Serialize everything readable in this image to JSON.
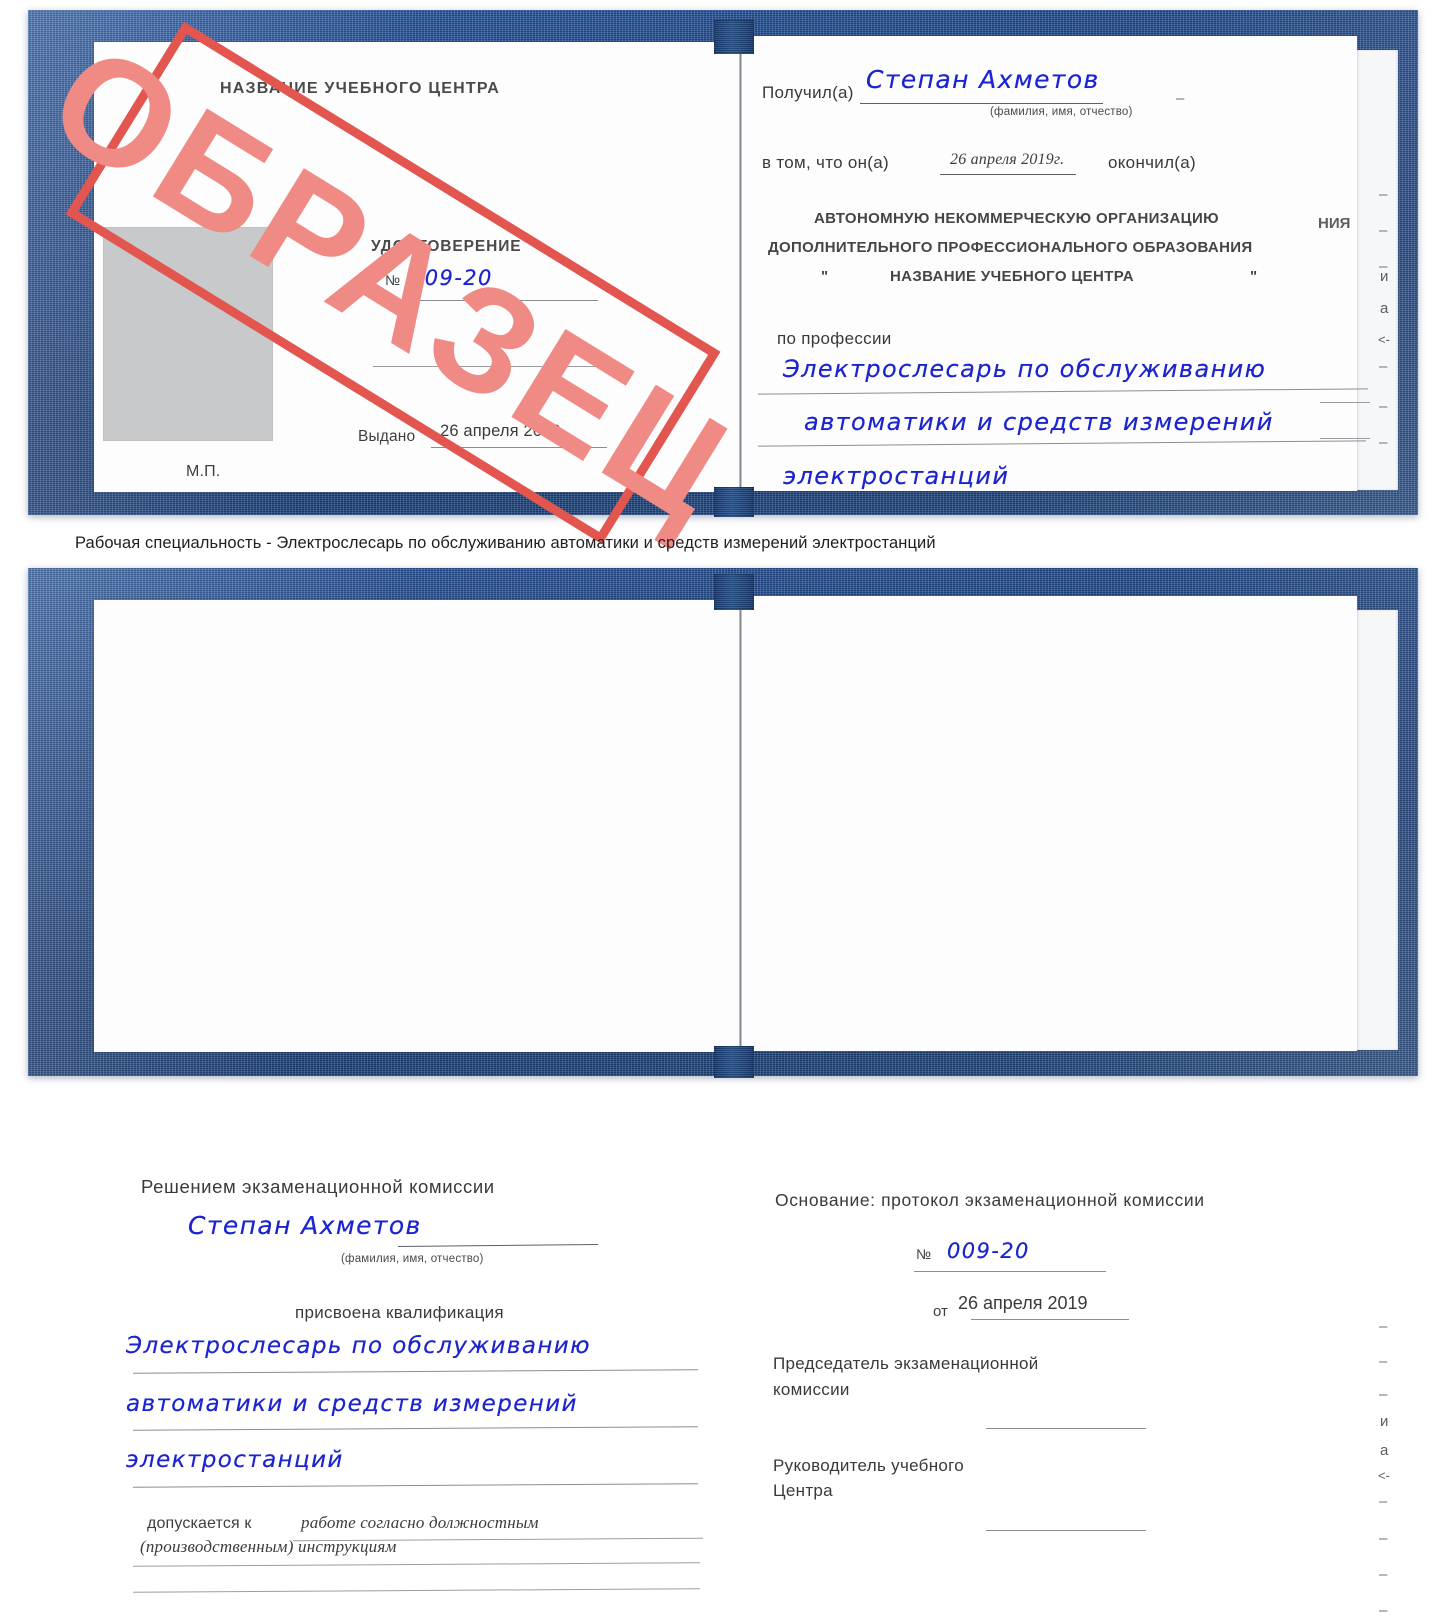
{
  "caption": {
    "text": "Рабочая специальность - Электрослесарь по обслуживанию автоматики и средств измерений электростанций"
  },
  "stamp": {
    "label": "ОБРАЗЕЦ",
    "color": "#e2564f",
    "text_color": "#ef8a85"
  },
  "colors": {
    "cover_blue": "#21497f",
    "pen_blue": "#1b24cf",
    "page_white": "#fdfdfd",
    "photo_gray": "#c8c9cb"
  },
  "certificate_top": {
    "left_page": {
      "center_name": "НАЗВАНИЕ УЧЕБНОГО ЦЕНТРА",
      "doc_title": "УДОСТОВЕРЕНИЕ",
      "number_symbol": "№",
      "number_value": "009-20",
      "issued_label": "Выдано",
      "issued_date": "26 апреля 2019",
      "seal_label": "М.П.",
      "photo_alt": "фотография"
    },
    "right_page": {
      "received_label": "Получил(а)",
      "received_name": "Степан Ахметов",
      "fio_hint": "(фамилия, имя, отчество)",
      "that_he_label": "в том, что он(а)",
      "completion_date": "26 апреля 2019г.",
      "finished_label": "окончил(а)",
      "org_line1": "АВТОНОМНУЮ НЕКОММЕРЧЕСКУЮ ОРГАНИЗАЦИЮ",
      "org_line2": "ДОПОЛНИТЕЛЬНОГО ПРОФЕССИОНАЛЬНОГО ОБРАЗОВАНИЯ",
      "org_quote_open": "\"",
      "org_line3": "НАЗВАНИЕ УЧЕБНОГО ЦЕНТРА",
      "org_quote_close": "\"",
      "profession_label": "по профессии",
      "profession_line1": "Электрослесарь по обслуживанию",
      "profession_line2": "автоматики и средств измерений",
      "profession_line3": "электростанций",
      "edge_fragment_1": "НИЯ",
      "edge_fragment_2": "и",
      "edge_fragment_3": "а",
      "edge_fragment_4": "<-"
    }
  },
  "certificate_bottom": {
    "left_page": {
      "decision_label": "Решением экзаменационной комиссии",
      "name": "Степан Ахметов",
      "fio_hint": "(фамилия, имя, отчество)",
      "qualification_label": "присвоена квалификация",
      "qualification_line1": "Электрослесарь по обслуживанию",
      "qualification_line2": "автоматики и средств измерений",
      "qualification_line3": "электростанций",
      "admitted_label": "допускается к",
      "admitted_value1": "работе согласно должностным",
      "admitted_value2": "(производственным) инструкциям"
    },
    "right_page": {
      "basis_label": "Основание: протокол экзаменационной комиссии",
      "number_symbol": "№",
      "number_value": "009-20",
      "date_prefix": "от",
      "date_value": "26 апреля 2019",
      "chairman_line1": "Председатель экзаменационной",
      "chairman_line2": "комиссии",
      "head_line1": "Руководитель учебного",
      "head_line2": "Центра",
      "edge_fragment_1": "и",
      "edge_fragment_2": "а",
      "edge_fragment_3": "<-"
    }
  }
}
